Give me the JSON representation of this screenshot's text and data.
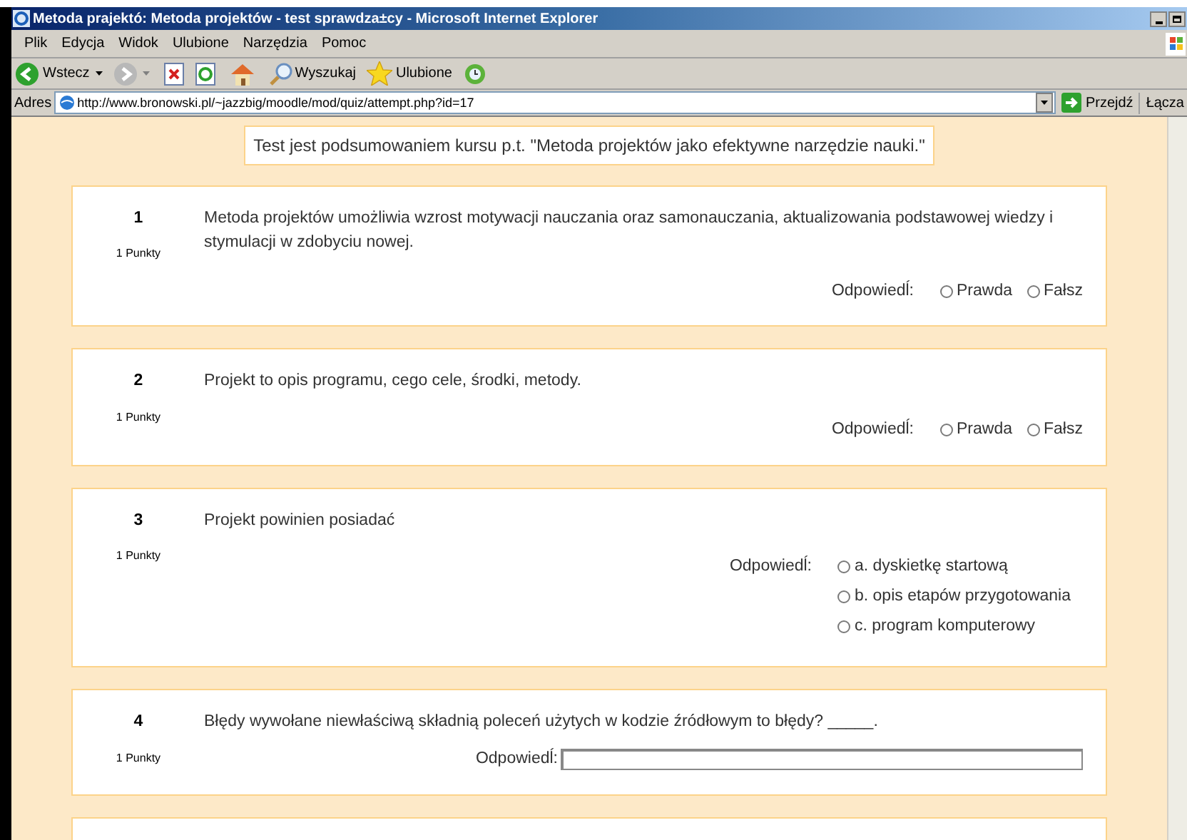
{
  "window": {
    "title": "Metoda prajektó: Metoda projektów - test sprawdza±cy - Microsoft Internet Explorer"
  },
  "menu": [
    "Plik",
    "Edycja",
    "Widok",
    "Ulubione",
    "Narzędzia",
    "Pomoc"
  ],
  "toolbar": {
    "back": "Wstecz",
    "search": "Wyszukaj",
    "favorites": "Ulubione"
  },
  "address": {
    "label": "Adres",
    "value": "http://www.bronowski.pl/~jazzbig/moodle/mod/quiz/attempt.php?id=17",
    "go": "Przejdź",
    "links": "Łącza"
  },
  "intro": "Test jest podsumowaniem kursu p.t. \"Metoda projektów jako efektywne narzędzie nauki.\"",
  "questions": [
    {
      "kind": "truefalse",
      "number": "1",
      "points": "1 Punkty",
      "text": "Metoda projektów umożliwia wzrost motywacji nauczania oraz samonauczania, aktualizowania podstawowej wiedzy i stymulacji w zdobyciu nowej.",
      "answer_label": "Odpowiedĺ:",
      "options": [
        {
          "label": "Prawda",
          "selected": false
        },
        {
          "label": "Fałsz",
          "selected": false
        }
      ]
    },
    {
      "kind": "truefalse",
      "number": "2",
      "points": "1 Punkty",
      "text": "Projekt to opis programu, cego cele, środki, metody.",
      "answer_label": "Odpowiedĺ:",
      "options": [
        {
          "label": "Prawda",
          "selected": false
        },
        {
          "label": "Fałsz",
          "selected": false
        }
      ]
    },
    {
      "kind": "multichoice",
      "number": "3",
      "points": "1 Punkty",
      "text": "Projekt powinien posiadać",
      "answer_label": "Odpowiedĺ:",
      "options": [
        {
          "label": "a. dyskietkę startową",
          "selected": false
        },
        {
          "label": "b. opis etapów przygotowania",
          "selected": false
        },
        {
          "label": "c. program komputerowy",
          "selected": false
        }
      ]
    },
    {
      "kind": "shortanswer",
      "number": "4",
      "points": "1 Punkty",
      "text": "Błędy wywołane niewłaściwą składnią poleceń użytych w kodzie źródłowym to błędy? _____.",
      "answer_label": "Odpowiedĺ:"
    }
  ]
}
